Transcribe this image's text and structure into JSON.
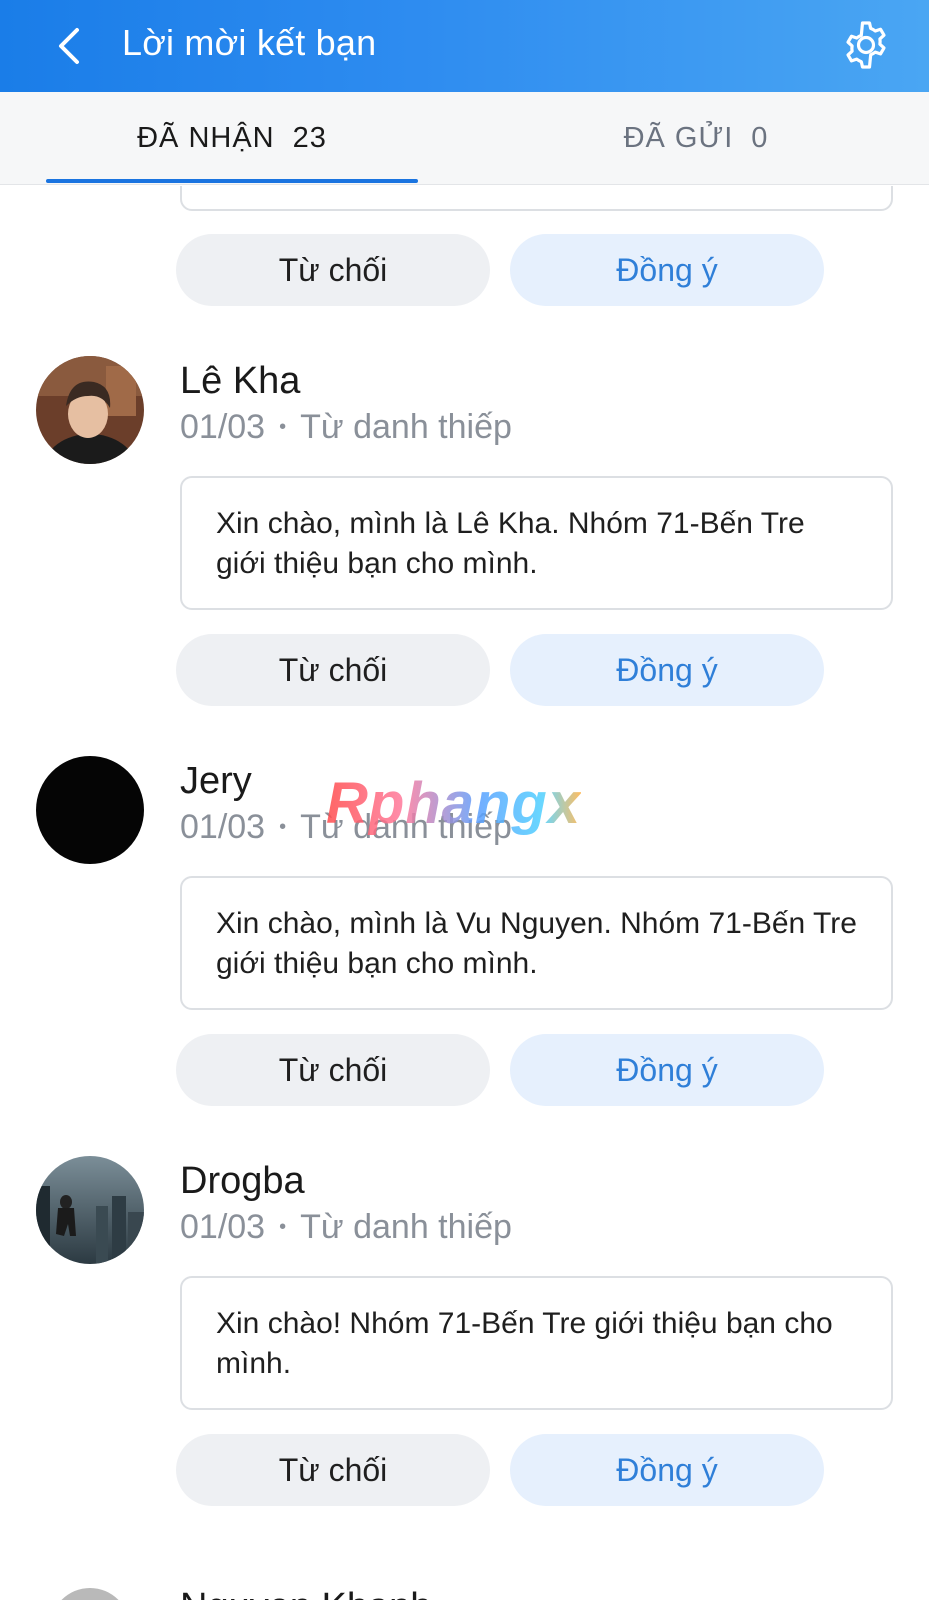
{
  "header": {
    "title": "Lời mời kết bạn",
    "back_icon": "chevron-left-icon",
    "settings_icon": "gear-icon"
  },
  "tabs": [
    {
      "label": "ĐÃ NHẬN",
      "count": "23",
      "active": true
    },
    {
      "label": "ĐÃ GỬI",
      "count": "0",
      "active": false
    }
  ],
  "buttons": {
    "decline": "Từ chối",
    "accept": "Đồng ý"
  },
  "requests": [
    {
      "name": "Lê Kha",
      "date": "01/03",
      "source": "Từ danh thiếp",
      "message": "Xin chào, mình là Lê Kha. Nhóm 71-Bến Tre giới thiệu bạn cho mình."
    },
    {
      "name": "Jery",
      "date": "01/03",
      "source": "Từ danh thiếp",
      "message": "Xin chào, mình là Vu Nguyen. Nhóm 71-Bến Tre giới thiệu bạn cho mình."
    },
    {
      "name": "Drogba",
      "date": "01/03",
      "source": "Từ danh thiếp",
      "message": "Xin chào! Nhóm 71-Bến Tre giới thiệu bạn cho mình."
    }
  ],
  "next_partial_name": "Nguyen Khanh",
  "watermark": "Rphangx",
  "colors": {
    "header_start": "#1a7de8",
    "header_end": "#4aa6f3",
    "accent": "#2f7fd8",
    "decline_bg": "#eef0f3",
    "accept_bg": "#e6f0fd"
  }
}
